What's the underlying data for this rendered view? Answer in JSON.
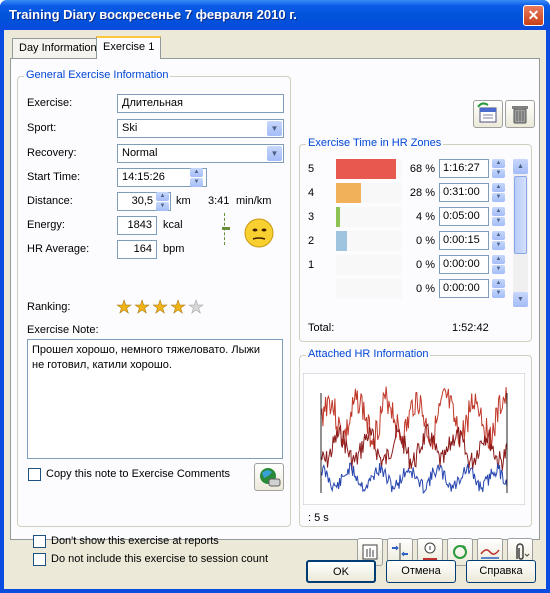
{
  "window": {
    "title": "Training Diary  воскресенье 7 февраля 2010 г."
  },
  "tabs": [
    {
      "label": "Day Information"
    },
    {
      "label": "Exercise 1"
    }
  ],
  "general": {
    "legend": "General Exercise Information",
    "exercise": {
      "label": "Exercise:",
      "value": "Длительная"
    },
    "sport": {
      "label": "Sport:",
      "value": "Ski"
    },
    "recovery": {
      "label": "Recovery:",
      "value": "Normal"
    },
    "start_time": {
      "label": "Start Time:",
      "value": "14:15:26"
    },
    "distance": {
      "label": "Distance:",
      "value": "30,5",
      "unit": "km",
      "pace": "3:41",
      "pace_unit": "min/km"
    },
    "energy": {
      "label": "Energy:",
      "value": "1843",
      "unit": "kcal"
    },
    "hr_average": {
      "label": "HR Average:",
      "value": "164",
      "unit": "bpm"
    },
    "ranking": {
      "label": "Ranking:",
      "stars": 4,
      "max": 5
    },
    "note": {
      "label": "Exercise Note:",
      "text": "Прошел хорошо, немного тяжеловато. Лыжи\nне готовил, катили хорошо."
    },
    "copy_note_label": "Copy this note to Exercise Comments"
  },
  "zones": {
    "legend": "Exercise Time in HR Zones",
    "rows": [
      {
        "zone": "5",
        "percent": 68,
        "percent_label": "68 %",
        "time": "1:16:27",
        "color": "#e8584e"
      },
      {
        "zone": "4",
        "percent": 28,
        "percent_label": "28 %",
        "time": "0:31:00",
        "color": "#f0b15a"
      },
      {
        "zone": "3",
        "percent": 4,
        "percent_label": "4 %",
        "time": "0:05:00",
        "color": "#8ec354"
      },
      {
        "zone": "2",
        "percent": 0,
        "percent_label": "0 %",
        "time": "0:00:15",
        "color": "#9ec4e0"
      },
      {
        "zone": "1",
        "percent": 0,
        "percent_label": "0 %",
        "time": "0:00:00",
        "color": "#cccccc"
      },
      {
        "zone": "",
        "percent": 0,
        "percent_label": "0 %",
        "time": "0:00:00",
        "color": "#cccccc"
      }
    ],
    "total_label": "Total:",
    "total_value": "1:52:42"
  },
  "hr_info": {
    "legend": "Attached HR Information",
    "interval": ": 5 s"
  },
  "options": {
    "dont_show": "Don't show this exercise at reports",
    "dont_count": "Do not include this exercise to session count"
  },
  "buttons": {
    "ok": "OK",
    "cancel": "Отмена",
    "help": "Справка"
  },
  "colors": {
    "accent": "#0046d5",
    "hr_red": "#c0392b",
    "hr_darkred": "#8b1a1a",
    "hr_blue": "#2846b0"
  }
}
